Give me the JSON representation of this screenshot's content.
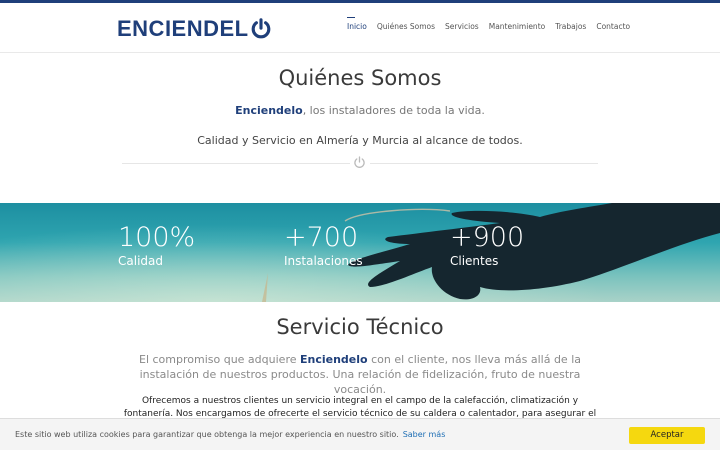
{
  "header": {
    "logo_text": "ENCIENDEL",
    "nav": [
      {
        "label": "Inicio",
        "active": true
      },
      {
        "label": "Quiénes Somos",
        "active": false
      },
      {
        "label": "Servicios",
        "active": false
      },
      {
        "label": "Mantenimiento",
        "active": false
      },
      {
        "label": "Trabajos",
        "active": false
      },
      {
        "label": "Contacto",
        "active": false
      }
    ]
  },
  "about": {
    "title": "Quiénes Somos",
    "brand": "Enciendelo",
    "tagline_rest": ", los instaladores de toda la vida.",
    "line2": "Calidad y Servicio en Almería y Murcia al alcance de todos.",
    "divider_icon": "power-icon"
  },
  "stats": [
    {
      "value": "100%",
      "label": "Calidad"
    },
    {
      "value": "+700",
      "label": "Instalaciones"
    },
    {
      "value": "+900",
      "label": "Clientes"
    }
  ],
  "service": {
    "title": "Servicio Técnico",
    "lead_before": "El compromiso que adquiere ",
    "lead_brand": "Enciendelo",
    "lead_after": " con el cliente, nos lleva más allá de la instalación de nuestros productos. Una relación de fidelización, fruto de nuestra vocación.",
    "body": "Ofrecemos a nuestros clientes un servicio integral en el campo de la calefacción, climatización y fontanería. Nos encargamos de ofrecerte el servicio técnico de su caldera o calentador, para asegurar el óptimo funcionamiento"
  },
  "cookie": {
    "text": "Este sitio web utiliza cookies para garantizar que obtenga la mejor experiencia en nuestro sitio.",
    "link": "Saber más",
    "button": "Aceptar"
  },
  "colors": {
    "brand": "#1f3f7a",
    "accept_button": "#f5d80f"
  }
}
